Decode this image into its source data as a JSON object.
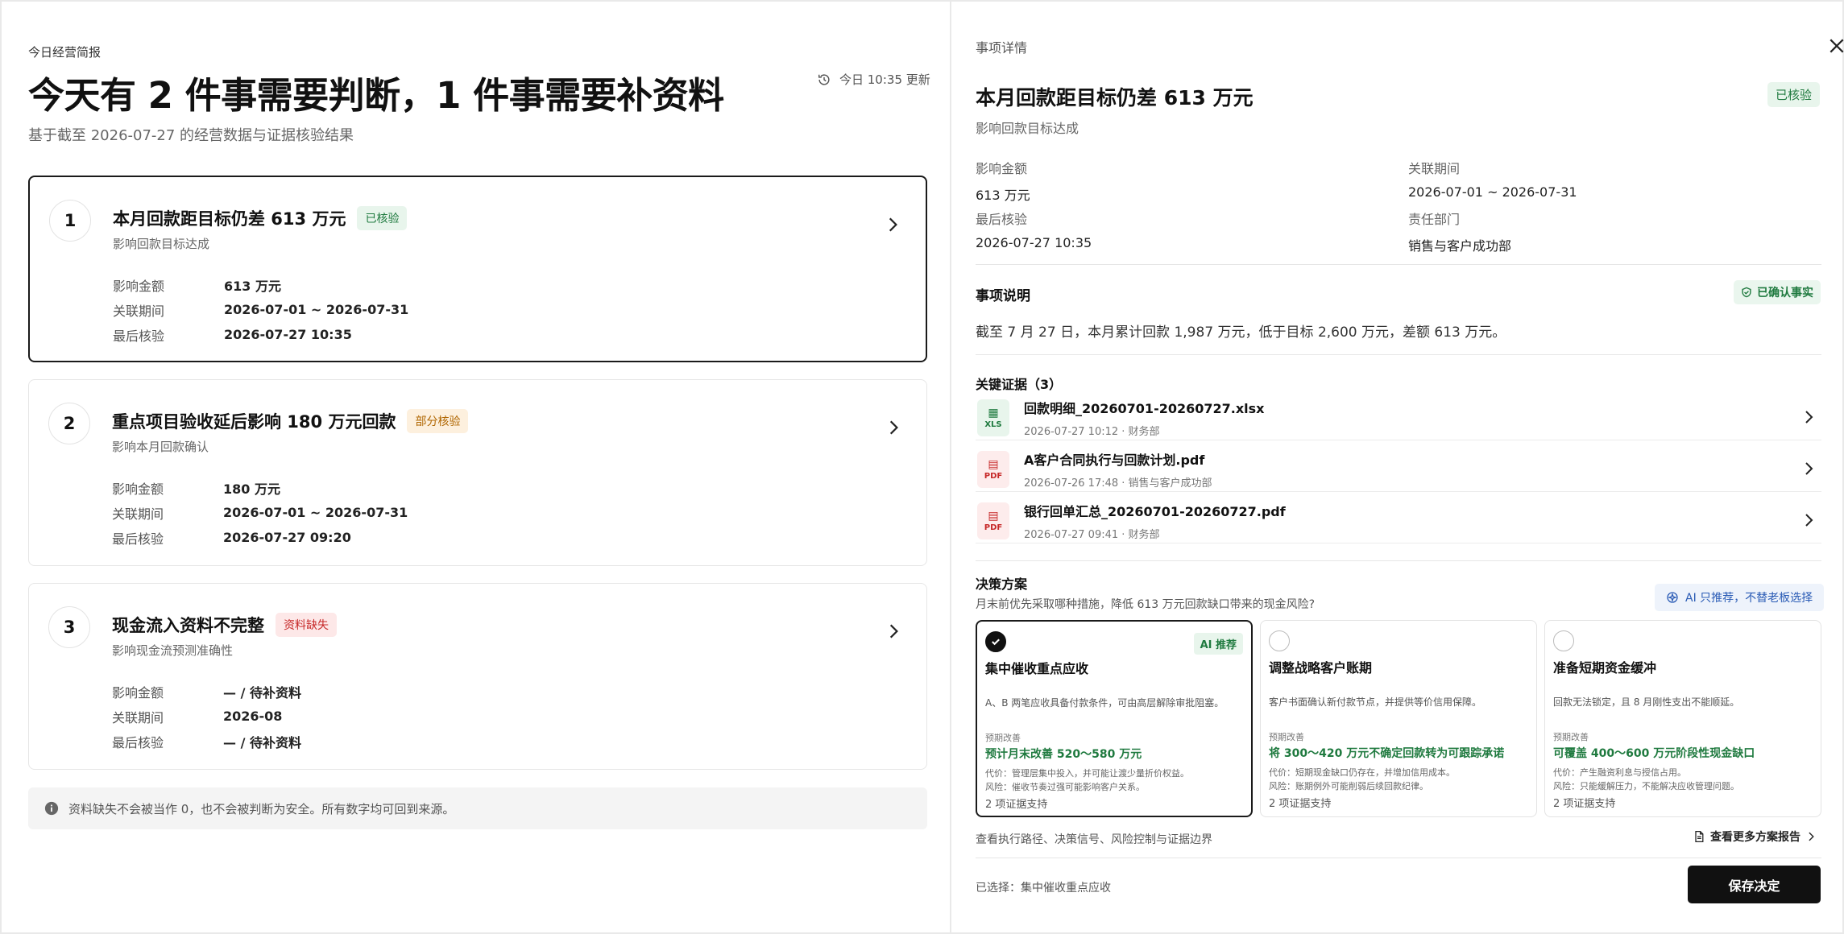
{
  "briefing": {
    "kicker": "今日经营简报",
    "headline": "今天有 2 件事需要判断，1 件事需要补资料",
    "subline": "基于截至 2026-07-27 的经营数据与证据核验结果",
    "updated": "今日 10:35 更新"
  },
  "labels": {
    "amount": "影响金额",
    "period": "关联期间",
    "last_check": "最后核验"
  },
  "items": [
    {
      "num": "1",
      "title": "本月回款距目标仍差 613 万元",
      "badge": "已核验",
      "badge_type": "green",
      "sub": "影响回款目标达成",
      "amount": "613 万元",
      "period": "2026-07-01 ~ 2026-07-31",
      "last_check": "2026-07-27 10:35"
    },
    {
      "num": "2",
      "title": "重点项目验收延后影响 180 万元回款",
      "badge": "部分核验",
      "badge_type": "orange",
      "sub": "影响本月回款确认",
      "amount": "180 万元",
      "period": "2026-07-01 ~ 2026-07-31",
      "last_check": "2026-07-27 09:20"
    },
    {
      "num": "3",
      "title": "现金流入资料不完整",
      "badge": "资料缺失",
      "badge_type": "red",
      "sub": "影响现金流预测准确性",
      "amount": "— / 待补资料",
      "period": "2026-08",
      "last_check": "— / 待补资料"
    }
  ],
  "footnote": "资料缺失不会被当作 0，也不会被判断为安全。所有数字均可回到来源。",
  "detail": {
    "kicker": "事项详情",
    "title": "本月回款距目标仍差 613 万元",
    "badge": "已核验",
    "sub": "影响回款目标达成",
    "meta": {
      "amount_label": "影响金额",
      "amount": "613 万元",
      "period_label": "关联期间",
      "period": "2026-07-01 ~ 2026-07-31",
      "check_label": "最后核验",
      "check": "2026-07-27 10:35",
      "dept_label": "责任部门",
      "dept": "销售与客户成功部"
    },
    "explain_title": "事项说明",
    "confirmed": "已确认事实",
    "explain": "截至 7 月 27 日，本月累计回款 1,987 万元，低于目标 2,600 万元，差额 613 万元。",
    "evidence_title": "关键证据（3）",
    "evidence": [
      {
        "name": "回款明细_20260701-20260727.xlsx",
        "meta": "2026-07-27 10:12 · 财务部",
        "ext": "XLS",
        "kind": "xlsx"
      },
      {
        "name": "A客户合同执行与回款计划.pdf",
        "meta": "2026-07-26 17:48 · 销售与客户成功部",
        "ext": "PDF",
        "kind": "pdf"
      },
      {
        "name": "银行回单汇总_20260701-20260727.pdf",
        "meta": "2026-07-27 09:41 · 财务部",
        "ext": "PDF",
        "kind": "pdf"
      }
    ],
    "decision_title": "决策方案",
    "decision_q": "月末前优先采取哪种措施，降低 613 万元回款缺口带来的现金风险?",
    "ai_note": "AI 只推荐，不替老板选择",
    "options": [
      {
        "title": "集中催收重点应收",
        "tag": "AI 推荐",
        "desc": "A、B 两笔应收具备付款条件，可由高层解除审批阻塞。",
        "label": "预期改善",
        "effect": "预计月末改善 520～580 万元",
        "cost": "代价：管理层集中投入，并可能让渡少量折价权益。",
        "risk": "风险：催收节奏过强可能影响客户关系。",
        "support": "2 项证据支持"
      },
      {
        "title": "调整战略客户账期",
        "tag": "",
        "desc": "客户书面确认新付款节点，并提供等价信用保障。",
        "label": "预期改善",
        "effect": "将 300～420 万元不确定回款转为可跟踪承诺",
        "cost": "代价：短期现金缺口仍存在，并增加信用成本。",
        "risk": "风险：账期例外可能削弱后续回款纪律。",
        "support": "2 项证据支持"
      },
      {
        "title": "准备短期资金缓冲",
        "tag": "",
        "desc": "回款无法锁定，且 8 月刚性支出不能顺延。",
        "label": "预期改善",
        "effect": "可覆盖 400～600 万元阶段性现金缺口",
        "cost": "代价：产生融资利息与授信占用。",
        "risk": "风险：只能缓解压力，不能解决应收管理问题。",
        "support": "2 项证据支持"
      }
    ],
    "path_note": "查看执行路径、决策信号、风险控制与证据边界",
    "more_link": "查看更多方案报告",
    "selected": "已选择：集中催收重点应收",
    "save": "保存决定"
  },
  "colors": {
    "accent_green": "#1f7a3f",
    "orange": "#b06600",
    "red": "#c62828",
    "ai_blue": "#2a5bb5",
    "primary_button": "#111111"
  },
  "icons": [
    "history-icon",
    "chevron-right-icon",
    "info-icon",
    "close-icon",
    "shield-check-icon",
    "xlsx-file-icon",
    "pdf-file-icon",
    "ai-sparkle-icon",
    "document-icon",
    "check-icon"
  ]
}
